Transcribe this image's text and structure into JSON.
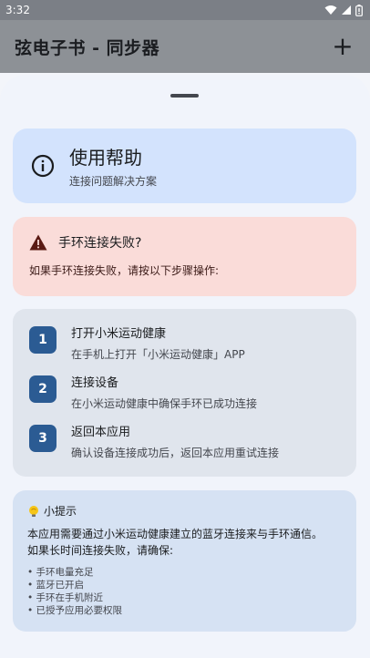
{
  "status_bar": {
    "time": "3:32"
  },
  "app_bar": {
    "title": "弦电子书 - 同步器",
    "add_label": "+"
  },
  "help_card": {
    "title": "使用帮助",
    "subtitle": "连接问题解决方案"
  },
  "alert": {
    "title": "手环连接失败?",
    "body": "如果手环连接失败，请按以下步骤操作:"
  },
  "steps": [
    {
      "number": "1",
      "title": "打开小米运动健康",
      "desc": "在手机上打开「小米运动健康」APP"
    },
    {
      "number": "2",
      "title": "连接设备",
      "desc": "在小米运动健康中确保手环已成功连接"
    },
    {
      "number": "3",
      "title": "返回本应用",
      "desc": "确认设备连接成功后，返回本应用重试连接"
    }
  ],
  "tips": {
    "title": "小提示",
    "body_line1": "本应用需要通过小米运动健康建立的蓝牙连接来与手环通信。",
    "body_line2": "如果长时间连接失败，请确保:",
    "items": [
      "手环电量充足",
      "蓝牙已开启",
      "手环在手机附近",
      "已授予应用必要权限"
    ]
  },
  "colors": {
    "help_bg": "#d3e3fd",
    "alert_bg": "#fadcd9",
    "steps_bg": "#e0e5ed",
    "step_badge": "#2b5b93",
    "tips_bg": "#d6e2f3",
    "warning_icon": "#5a1a14",
    "bulb_icon": "#f5c518"
  },
  "icons": {
    "wifi": "wifi-icon",
    "battery": "battery-icon",
    "info": "info-icon",
    "warning": "warning-icon",
    "bulb": "bulb-icon"
  }
}
